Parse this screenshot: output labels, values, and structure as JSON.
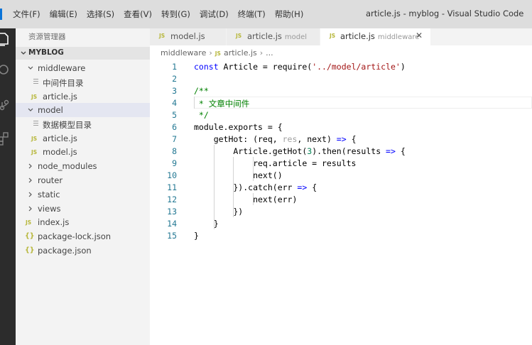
{
  "window_title": "article.js - myblog - Visual Studio Code",
  "menu": [
    "文件(F)",
    "编辑(E)",
    "选择(S)",
    "查看(V)",
    "转到(G)",
    "调试(D)",
    "终端(T)",
    "帮助(H)"
  ],
  "activity_bar": [
    "files-icon",
    "search-icon",
    "source-control-icon",
    "extensions-icon"
  ],
  "sidebar": {
    "title": "资源管理器",
    "section": "MYBLOG",
    "items": [
      {
        "label": "middleware",
        "type": "folder",
        "expanded": true
      },
      {
        "label": "中间件目录",
        "type": "text"
      },
      {
        "label": "article.js",
        "type": "js"
      },
      {
        "label": "model",
        "type": "folder",
        "expanded": true,
        "selected": true
      },
      {
        "label": "数据模型目录",
        "type": "text"
      },
      {
        "label": "article.js",
        "type": "js"
      },
      {
        "label": "model.js",
        "type": "js"
      },
      {
        "label": "node_modules",
        "type": "folder",
        "expanded": false
      },
      {
        "label": "router",
        "type": "folder",
        "expanded": false
      },
      {
        "label": "static",
        "type": "folder",
        "expanded": false
      },
      {
        "label": "views",
        "type": "folder",
        "expanded": false
      },
      {
        "label": "index.js",
        "type": "js"
      },
      {
        "label": "package-lock.json",
        "type": "json"
      },
      {
        "label": "package.json",
        "type": "json"
      }
    ]
  },
  "tabs": [
    {
      "icon": "JS",
      "name": "model.js",
      "desc": ""
    },
    {
      "icon": "JS",
      "name": "article.js",
      "desc": "model"
    },
    {
      "icon": "JS",
      "name": "article.js",
      "desc": "middleware",
      "active": true,
      "close": "✕"
    }
  ],
  "breadcrumb": {
    "folder": "middleware",
    "file_icon": "JS",
    "file": "article.js",
    "separator": "›",
    "more": "..."
  },
  "line_numbers": [
    "1",
    "2",
    "3",
    "4",
    "5",
    "6",
    "7",
    "8",
    "9",
    "10",
    "11",
    "12",
    "13",
    "14",
    "15"
  ],
  "code": {
    "l1": {
      "kw": "const",
      "a": " Article = require(",
      "str": "'../model/article'",
      "b": ")"
    },
    "l3": "/**",
    "l4": " * 文章中间件",
    "l5": " */",
    "l6": "module.exports = {",
    "l7": {
      "a": "    getHot: (req, ",
      "muted": "res",
      "b": ", next) ",
      "kw": "=>",
      "c": " {"
    },
    "l8": {
      "a": "        Article.getHot(",
      "num": "3",
      "b": ").then(results ",
      "kw": "=>",
      "c": " {"
    },
    "l9": "            req.article = results",
    "l10": "            next()",
    "l11": {
      "a": "        }).catch(err ",
      "kw": "=>",
      "b": " {"
    },
    "l12": "            next(err)",
    "l13": "        })",
    "l14": "    }",
    "l15": "}"
  }
}
